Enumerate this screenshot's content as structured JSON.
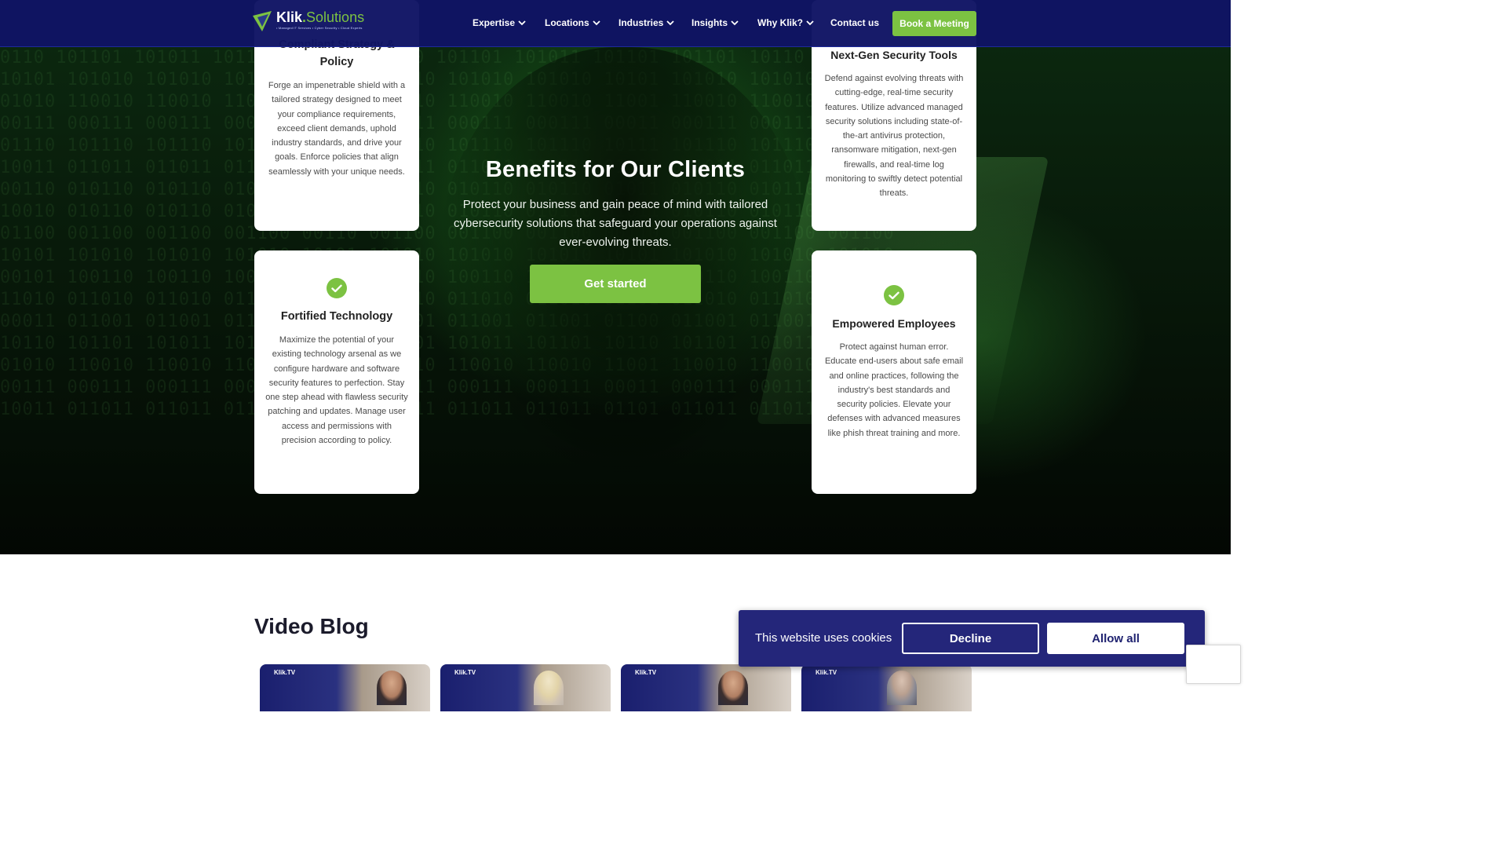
{
  "nav": {
    "logo_brand": "Klik",
    "logo_dot": ".",
    "logo_suffix": "Solutions",
    "logo_tagline": "• Managed IT Services • Cyber Security • Cloud Experts",
    "menu": [
      {
        "label": "Expertise"
      },
      {
        "label": "Locations"
      },
      {
        "label": "Industries"
      },
      {
        "label": "Insights"
      },
      {
        "label": "Why Klik?"
      },
      {
        "label": "Contact us"
      }
    ],
    "book_label": "Book a Meeting"
  },
  "hero": {
    "title": "Benefits for Our Clients",
    "subtitle": "Protect your business and gain peace of mind with tailored cybersecurity solutions that safeguard your operations against ever-evolving threats.",
    "cta_label": "Get started"
  },
  "cards": [
    {
      "title": "Compliant Strategy & Policy",
      "text": "Forge an impenetrable shield with a tailored strategy designed to meet your compliance requirements, exceed client demands, uphold industry standards, and drive your goals. Enforce policies that align seamlessly with your unique needs."
    },
    {
      "title": "Next-Gen Security Tools",
      "text": "Defend against evolving threats with cutting-edge, real-time security features. Utilize advanced managed security solutions including state-of-the-art antivirus protection, ransomware mitigation, next-gen firewalls, and real-time log monitoring to swiftly detect potential threats."
    },
    {
      "title": "Fortified Technology",
      "text": "Maximize the potential of your existing technology arsenal as we configure hardware and software security features to perfection. Stay one step ahead with flawless security patching and updates. Manage user access and permissions with precision according to policy."
    },
    {
      "title": "Empowered Employees",
      "text": "Protect against human error. Educate end-users about safe email and online practices, following the industry's best standards and security policies. Elevate your defenses with advanced measures like phish threat training and more."
    }
  ],
  "video_blog": {
    "title": "Video Blog",
    "thumbs": [
      {
        "label": "Klik.TV"
      },
      {
        "label": "Klik.TV"
      },
      {
        "label": "Klik.TV"
      },
      {
        "label": "Klik.TV"
      }
    ]
  },
  "cookie": {
    "text": "This website uses cookies",
    "decline_label": "Decline",
    "allow_label": "Allow all"
  },
  "colors": {
    "nav_bg": "#0f1464",
    "accent_green": "#7cc242",
    "cookie_bg": "#24267a"
  },
  "icons": {
    "check": "check-circle-icon",
    "chevron": "chevron-down-icon",
    "logo": "klik-logo-icon"
  }
}
